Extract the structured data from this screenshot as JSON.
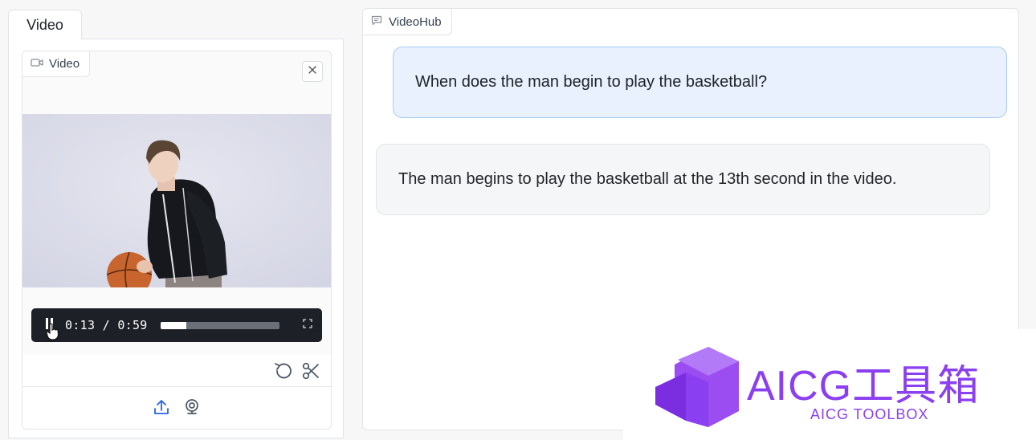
{
  "video_panel": {
    "tab_label": "Video",
    "box_label": "Video",
    "player": {
      "time_display": "0:13 / 0:59",
      "progress": 0.22
    }
  },
  "chat_panel": {
    "title": "VideoHub",
    "messages": [
      {
        "role": "user",
        "text": "When does the man begin to play the basketball?"
      },
      {
        "role": "assistant",
        "text": "The man begins to play the basketball at the 13th second in the video."
      }
    ]
  },
  "watermark": {
    "title": "AICG工具箱",
    "subtitle": "AICG TOOLBOX"
  },
  "colors": {
    "accent": "#8a3ff0",
    "user_bubble": "#e8f1fd",
    "user_border": "#a8cbf3",
    "bot_bubble": "#f5f6f7",
    "controls_bg": "#1d2026"
  },
  "icons": [
    "video-camera-icon",
    "close-icon",
    "pause-icon",
    "hand-cursor-icon",
    "fullscreen-icon",
    "undo-icon",
    "scissors-icon",
    "upload-icon",
    "webcam-icon",
    "chat-icon",
    "logo-icon"
  ]
}
